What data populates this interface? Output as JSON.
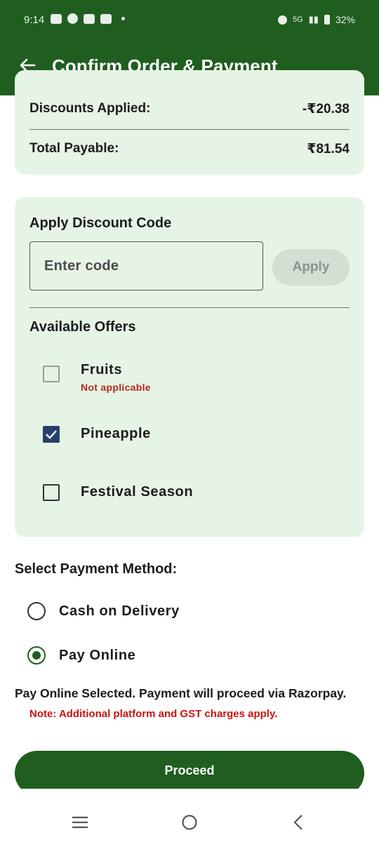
{
  "status_bar": {
    "time": "9:14",
    "network": "5G",
    "battery": "32%"
  },
  "app_bar": {
    "title": "Confirm Order & Payment"
  },
  "summary": {
    "discount_label": "Discounts Applied:",
    "discount_value": "-₹20.38",
    "total_label": "Total Payable:",
    "total_value": "₹81.54"
  },
  "discount_code": {
    "heading": "Apply Discount Code",
    "placeholder": "Enter code",
    "apply_label": "Apply"
  },
  "offers": {
    "heading": "Available Offers",
    "items": [
      {
        "name": "Fruits",
        "note": "Not applicable",
        "checked": false,
        "disabled": true
      },
      {
        "name": "Pineapple",
        "checked": true
      },
      {
        "name": "Festival Season",
        "checked": false
      }
    ]
  },
  "payment": {
    "heading": "Select Payment Method:",
    "options": [
      {
        "label": "Cash on Delivery",
        "selected": false
      },
      {
        "label": "Pay Online",
        "selected": true
      }
    ],
    "selected_info": "Pay Online Selected. Payment will proceed via Razorpay.",
    "note": "Note: Additional platform and GST charges apply."
  },
  "proceed_label": "Proceed",
  "colors": {
    "primary": "#1f5e1f",
    "card_bg": "#e6f4e6",
    "checkbox_checked": "#28406e",
    "warning": "#c9130f"
  }
}
